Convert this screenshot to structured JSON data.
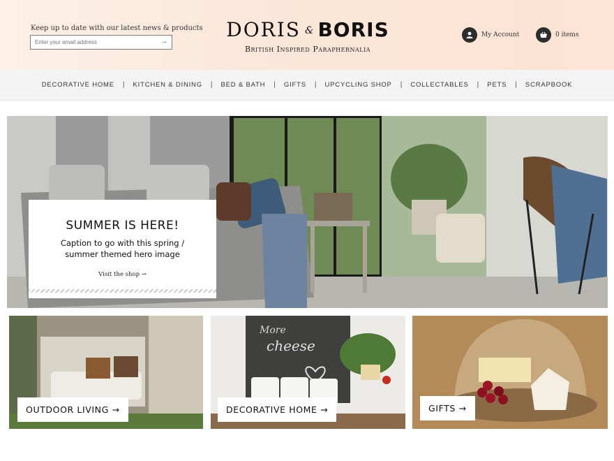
{
  "header": {
    "newsletter_label": "Keep up to date with our latest news & products",
    "newsletter_placeholder": "Enter your email address",
    "newsletter_submit": "→",
    "logo_word_1": "DORIS",
    "logo_ampersand": "&",
    "logo_word_2": "BORIS",
    "tagline": "British Inspired Paraphernalia",
    "account_label": "My Account",
    "cart_label": "0 items"
  },
  "nav": {
    "items": [
      {
        "label": "Decorative Home"
      },
      {
        "label": "Kitchen & Dining"
      },
      {
        "label": "Bed & Bath"
      },
      {
        "label": "Gifts"
      },
      {
        "label": "Upcycling Shop"
      },
      {
        "label": "Collectables"
      },
      {
        "label": "Pets"
      },
      {
        "label": "Scrapbook"
      }
    ],
    "separator": "|"
  },
  "hero": {
    "title": "SUMMER IS HERE!",
    "subtitle": "Caption to go with this spring / summer themed hero image",
    "link_text": "Visit the shop →"
  },
  "tiles": [
    {
      "label": "OUTDOOR LIVING →"
    },
    {
      "label": "DECORATIVE HOME →"
    },
    {
      "label": "GIFTS →"
    }
  ],
  "colors": {
    "header_bg": "#fbe6d8",
    "nav_bg": "#f4f4f4",
    "text_dark": "#111111"
  },
  "icons": {
    "account": "user-icon",
    "cart": "basket-icon"
  }
}
